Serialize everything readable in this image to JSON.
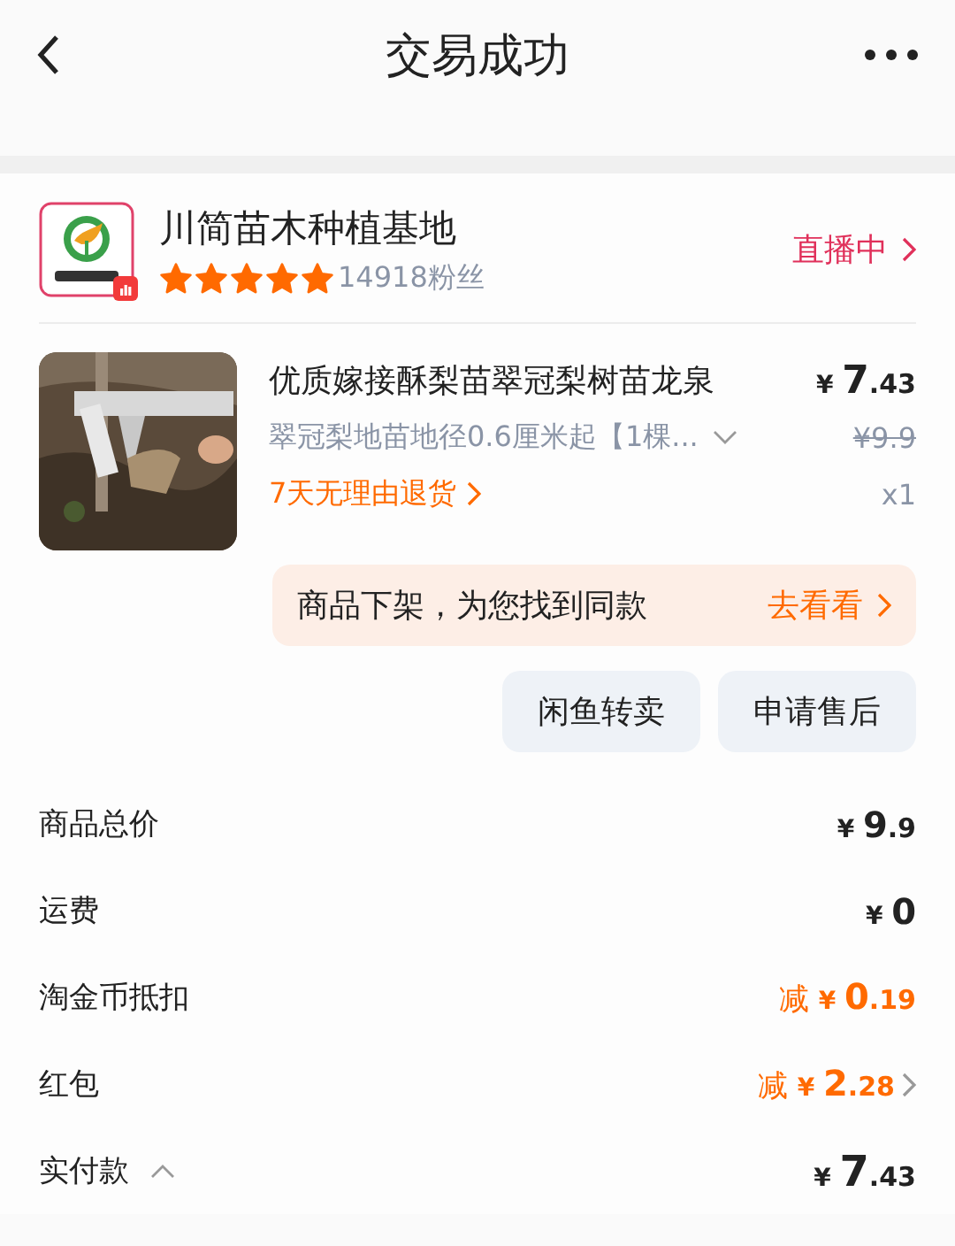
{
  "header": {
    "title": "交易成功"
  },
  "shop": {
    "name": "川简苗木种植基地",
    "stars": 5,
    "fans": "14918粉丝",
    "live": "直播中"
  },
  "product": {
    "title": "优质嫁接酥梨苗翠冠梨树苗龙泉",
    "sku": "翠冠梨地苗地径0.6厘米起【1棵...",
    "price": {
      "currency": "¥",
      "main": "7",
      "fraction": ".43"
    },
    "original_price": "¥9.9",
    "return_policy": "7天无理由退货",
    "quantity": "x1"
  },
  "notice": {
    "text": "商品下架，为您找到同款",
    "action": "去看看"
  },
  "buttons": [
    "闲鱼转卖",
    "申请售后"
  ],
  "summary": [
    {
      "label": "商品总价",
      "kind": "plain",
      "price": {
        "currency": "¥",
        "main": "9",
        "fraction": ".9"
      },
      "link": false,
      "expandable": false
    },
    {
      "label": "运费",
      "kind": "plain",
      "price": {
        "currency": "¥",
        "main": "0"
      },
      "link": false,
      "expandable": false
    },
    {
      "label": "淘金币抵扣",
      "kind": "discount",
      "prefix": "减",
      "price": {
        "currency": "¥",
        "main": "0",
        "fraction": ".19"
      },
      "link": false,
      "expandable": false
    },
    {
      "label": "红包",
      "kind": "discount",
      "prefix": "减",
      "price": {
        "currency": "¥",
        "main": "2",
        "fraction": ".28"
      },
      "link": true,
      "expandable": false
    },
    {
      "label": "实付款",
      "kind": "total",
      "price": {
        "currency": "¥",
        "main": "7",
        "fraction": ".43"
      },
      "link": false,
      "expandable": true
    }
  ]
}
